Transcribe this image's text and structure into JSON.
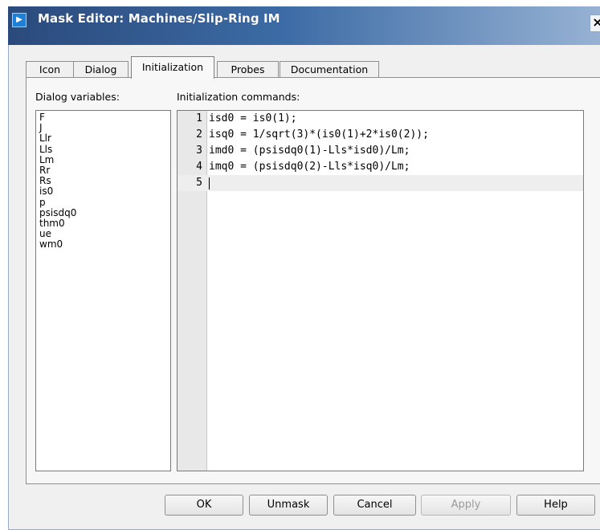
{
  "window": {
    "title": "Mask Editor: Machines/Slip-Ring IM",
    "close_glyph": "×",
    "icon_glyph": "▶"
  },
  "tabs": [
    {
      "label": "Icon",
      "active": false
    },
    {
      "label": "Dialog",
      "active": false
    },
    {
      "label": "Initialization",
      "active": true
    },
    {
      "label": "Probes",
      "active": false
    },
    {
      "label": "Documentation",
      "active": false
    }
  ],
  "dialog_variables": {
    "label": "Dialog variables:",
    "items": [
      "F",
      "J",
      "Llr",
      "Lls",
      "Lm",
      "Rr",
      "Rs",
      "is0",
      "p",
      "psisdq0",
      "thm0",
      "ue",
      "wm0"
    ]
  },
  "initialization": {
    "label": "Initialization commands:",
    "lines": [
      {
        "num": "1",
        "code": "isd0 = is0(1);"
      },
      {
        "num": "2",
        "code": "isq0 = 1/sqrt(3)*(is0(1)+2*is0(2));"
      },
      {
        "num": "3",
        "code": "imd0 = (psisdq0(1)-Lls*isd0)/Lm;"
      },
      {
        "num": "4",
        "code": "imq0 = (psisdq0(2)-Lls*isq0)/Lm;"
      },
      {
        "num": "5",
        "code": ""
      }
    ],
    "current_line": 5
  },
  "buttons": {
    "ok": "OK",
    "unmask": "Unmask",
    "cancel": "Cancel",
    "apply": "Apply",
    "help": "Help"
  },
  "colors": {
    "title_bar_start": "#2b4a7c",
    "title_bar_end": "#9cb6d6",
    "dialog_bg": "#f0f0f0"
  }
}
